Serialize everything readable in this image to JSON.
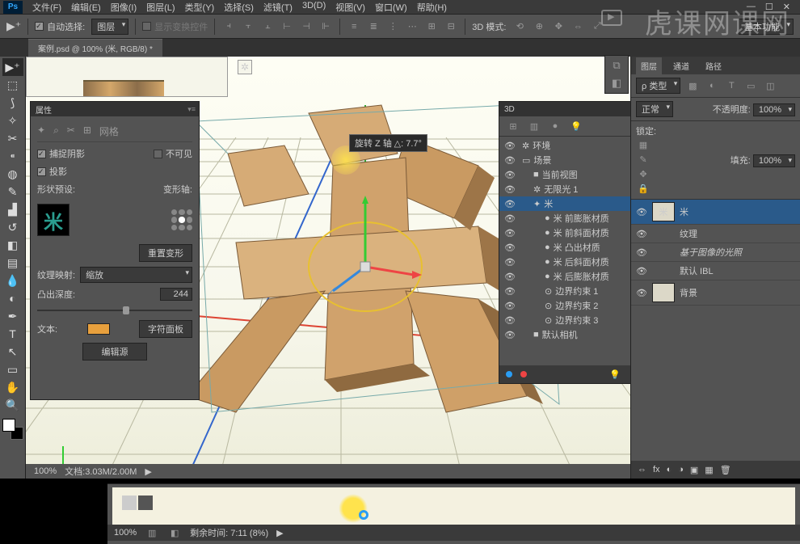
{
  "menu": {
    "items": [
      "文件(F)",
      "编辑(E)",
      "图像(I)",
      "图层(L)",
      "类型(Y)",
      "选择(S)",
      "滤镜(T)",
      "3D(D)",
      "视图(V)",
      "窗口(W)",
      "帮助(H)"
    ]
  },
  "window": {
    "min": "—",
    "max": "☐",
    "close": "✕"
  },
  "options": {
    "auto_select": "自动选择:",
    "layer_dd": "图层",
    "show_transform": "显示变换控件",
    "mode3d": "3D 模式:",
    "basic": "基本功能"
  },
  "doc": {
    "tab": "案例.psd @ 100% (米, RGB/8) *"
  },
  "props": {
    "title": "属性",
    "mesh_label": "网格",
    "catch_shadow": "捕捉阴影",
    "invisible": "不可见",
    "cast_shadow": "投影",
    "shape_preset": "形状预设:",
    "deform_axis": "变形轴:",
    "reset_deform": "重置变形",
    "texture_map": "纹理映射:",
    "texture_map_val": "缩放",
    "extrude_depth": "凸出深度:",
    "extrude_val": "244",
    "text_label": "文本:",
    "char_panel": "字符面板",
    "edit_source": "编辑源"
  },
  "tooltip": {
    "rotate": "旋转 Z 轴",
    "delta": "△: 7.7°"
  },
  "panel3d": {
    "title": "3D",
    "items": [
      {
        "i": 0,
        "ic": "✲",
        "t": "环境"
      },
      {
        "i": 0,
        "ic": "▭",
        "t": "场景"
      },
      {
        "i": 1,
        "ic": "■",
        "t": "当前视图"
      },
      {
        "i": 1,
        "ic": "✲",
        "t": "无限光 1"
      },
      {
        "i": 1,
        "ic": "✦",
        "t": "米",
        "sel": true
      },
      {
        "i": 2,
        "ic": "●",
        "t": "米 前膨胀材质"
      },
      {
        "i": 2,
        "ic": "●",
        "t": "米 前斜面材质"
      },
      {
        "i": 2,
        "ic": "●",
        "t": "米 凸出材质"
      },
      {
        "i": 2,
        "ic": "●",
        "t": "米 后斜面材质"
      },
      {
        "i": 2,
        "ic": "●",
        "t": "米 后膨胀材质"
      },
      {
        "i": 2,
        "ic": "⊙",
        "t": "边界约束 1"
      },
      {
        "i": 2,
        "ic": "⊙",
        "t": "边界约束 2"
      },
      {
        "i": 2,
        "ic": "⊙",
        "t": "边界约束 3"
      },
      {
        "i": 1,
        "ic": "■",
        "t": "默认相机"
      }
    ]
  },
  "layers": {
    "tab1": "图层",
    "tab2": "通道",
    "tab3": "路径",
    "kind": "ρ 类型",
    "blend": "正常",
    "opacity_l": "不透明度:",
    "opacity_v": "100%",
    "lock": "锁定:",
    "fill_l": "填充:",
    "fill_v": "100%",
    "items": [
      {
        "name": "米",
        "sel": true,
        "thumb": "米"
      },
      {
        "name": "纹理",
        "sub": true
      },
      {
        "name": "基于图像的光照",
        "sub": true,
        "em": true
      },
      {
        "name": "默认 IBL",
        "sub": true
      },
      {
        "name": "背景",
        "thumb": "bg"
      }
    ]
  },
  "status": {
    "zoom": "100%",
    "doc": "文档:3.03M/2.00M"
  },
  "timeline": {
    "zoom": "100%",
    "time": "剩余时间: 7:11 (8%)"
  },
  "watermark": "虎课网课网"
}
